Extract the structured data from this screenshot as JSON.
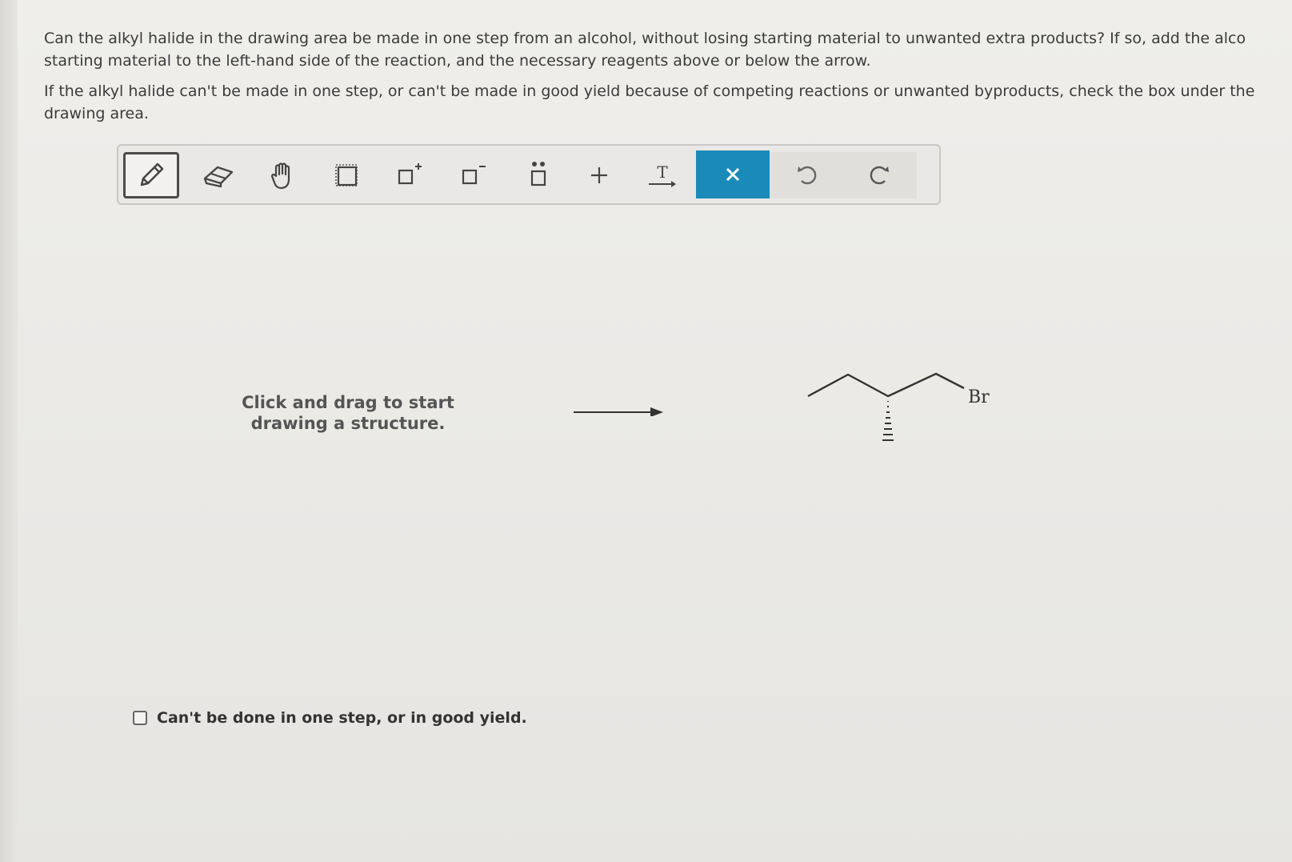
{
  "question": {
    "paragraph1_line1": "Can the alkyl halide in the drawing area be made in one step from an alcohol, without losing starting material to unwanted extra products? If so, add the alco",
    "paragraph1_line2": "starting material to the left-hand side of the reaction, and the necessary reagents above or below the arrow.",
    "paragraph2_line1": "If the alkyl halide can't be made in one step, or can't be made in good yield because of competing reactions or unwanted byproducts, check the box under the",
    "paragraph2_line2": "drawing area."
  },
  "toolbar": {
    "tools": [
      {
        "name": "pencil-tool",
        "icon": "pencil-icon",
        "active": true
      },
      {
        "name": "eraser-tool",
        "icon": "eraser-icon",
        "active": false
      },
      {
        "name": "hand-tool",
        "icon": "hand-icon",
        "active": false
      },
      {
        "name": "select-tool",
        "icon": "selection-box-icon",
        "active": false
      },
      {
        "name": "positive-charge-tool",
        "icon": "charge-plus-icon",
        "active": false
      },
      {
        "name": "negative-charge-tool",
        "icon": "charge-minus-icon",
        "active": false
      },
      {
        "name": "lone-pair-tool",
        "icon": "lone-pair-icon",
        "active": false
      },
      {
        "name": "add-plus-tool",
        "icon": "plus-icon",
        "active": false
      },
      {
        "name": "text-arrow-tool",
        "icon": "text-arrow-icon",
        "active": false
      },
      {
        "name": "clear-tool",
        "icon": "close-icon",
        "active": false
      },
      {
        "name": "undo-tool",
        "icon": "undo-icon",
        "active": false
      },
      {
        "name": "redo-tool",
        "icon": "redo-icon",
        "active": false
      }
    ],
    "text_tool_glyph": "T",
    "colors": {
      "clear_button": "#1a8ab8",
      "active_border": "#4b4b4b"
    }
  },
  "drawing": {
    "hint_line1": "Click and drag to start",
    "hint_line2": "drawing a structure.",
    "product_atom_label": "Br"
  },
  "option": {
    "checkbox_label": "Can't be done in one step, or in good yield.",
    "checked": false
  }
}
